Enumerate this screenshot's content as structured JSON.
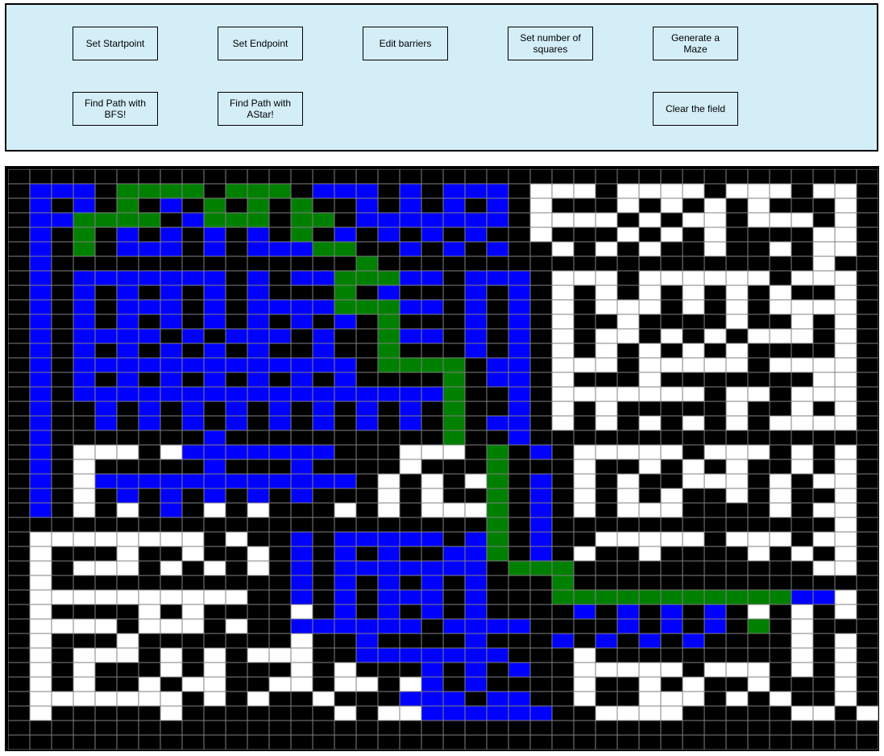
{
  "toolbar": {
    "set_startpoint": "Set Startpoint",
    "set_endpoint": "Set Endpoint",
    "edit_barriers": "Edit barriers",
    "set_number_of_squares": "Set number of squares",
    "generate_maze": "Generate a Maze",
    "find_path_bfs": "Find Path with BFS!",
    "find_path_astar": "Find Path with AStar!",
    "clear_field": "Clear the field"
  },
  "colors": {
    "panel": "#d4eef8",
    "wall": "#000000",
    "open": "#ffffff",
    "visited": "#0000ff",
    "path": "#008000",
    "gridline": "#808080"
  },
  "maze": {
    "cols": 40,
    "rows": 40,
    "legend": "B = wall, . = open, b = visited (blue), g = path (green)",
    "cells": [
      "BBBBBBBBBBBBBBBBBBBBBBBBBBBBBBBBBBBBBBBB",
      "BbbbBggggBgggBbbbBbBbbbB...B....B...B..B",
      "BbBbBgBbBgBgBgBBbBbBbBbB.BBB.B.B.B.BBB.B",
      "BbbggggBbgggBggBbbbbbbbB....B.B..B...B.B",
      "BbBgBbBbBbBbBgBbBbBbBbBB.BBB.B.B.BBBB..B",
      "BbBgBbbbBbBbbbggBBbBbBbBB.B.B.BB.BB.B..B",
      "BbBBBBBBBBBBBBBBgBBBBBBBBBBBBBBBBBBBB.BB",
      "BbBbbbbbbbBbBbbgggbbBbbbB...B......B...B",
      "BbBbBbBbBbBbBBBgBbBBBbBbB.B.B.B.B.B.BB.B",
      "BbBbBbbbBbBbbbbgggbbBbBbB.B...B.B.B....B",
      "BbBbBbBbBbBbBbBbBgBBBbBbB.BB.BBBB.BB.B.B",
      "BbBbbbbBbBbbbBbBBgbbBbBbB.B..B.B.B...B.B",
      "BbBbBbBbBbBbBBbBBgBBBbBbB.B.B.B.B.BBBB.B",
      "BbBbbbbbbbbbbbbbBggggBbbB...B.....B....B",
      "BbBbBbBbBbBbBbBbBBBBgBbbB.BBB.BBBBBBB..B",
      "BbBbbbbbbbbbbbbbbbbbgBBbB.......B..B...B",
      "BbBBbBbBbBbBbBbBbBbBgBBbB.B.BBBBB.BB.B.B",
      "BbBBbBbBbBbBbBbBbBbBgBbbB.B.B.B.B.B....B",
      "BbBBBBBBBbBBBBBBBBBBgBBbBBBBBBBBBBBBBBBB",
      "BbB...B.bbbbbbbBBB...BgBbB.....B...B.B.B",
      "BbB.BBBBBbBBBbBBBB.BBBgBBB.BB.B.B.BB.B.B",
      "BbB.bbbbbbbbbbbbB.B.B.gBbB.B.BB...B.B..B",
      "BbB.BbBbBbBbBbBBB.B.BBgBbB.B.B.BB.B.BB.B",
      "BbB.B.BbB.B.BBB.B.B...gBbB.B...BBBB.B..B",
      "BBBBBBBBBBBBBBBBBBBBBBgBbBBBBBBBBBBBBB.B",
      "B........B.BBbBbbbbbBbgBbBB.....B...B..B",
      "B.BBB.BB.BB.BbBbBbBBbbgBbB.BB.BBBB.B.B.B",
      "B.B...B.B.B.BbBbbbbbbbBgggBBBBBBBBBBB..B",
      "B.BBBBBBBBBBBbBbBbBbBbBBBgBBBBBBBBBBBBBB",
      "B..........BBbBbBbbbBbBBBgggggggggggbb.B",
      "B.BBBB.B.BBBB.BbBbBbBbBBBBbBbBbBbB.B.B.B",
      "B....B...B.BBbbbbbbBbbbbBBBBbBbBbBgB.BBB",
      "B.BBB.BBBBBBB.BBbBBBBbBBBbBbBbBbBBBB.B.B",
      "B.B...B.B.B...BBbbbbbbbBBB.BBBBBBBBB.B.B",
      "B.B.BBB.B.BBB.B.BBBbBbBbBB.....B...B.B.B",
      "B.B.BB.B..BB..B..B.bBbBBBB.BB.B.BB.BBB.B",
      "B.......B.B.BB.BBBbbbBbbBB.BB...B.B.BB.B",
      "B.BBBBB.BBBBBBB.B..bbbbbbBB....BBBBB..B.B",
      "BBBBBBBBBBBBBBBBBBBBBBBBBBBBBBBBBBBBBBBB",
      "BBBBBBBBBBBBBBBBBBBBBBBBBBBBBBBBBBBBBBBB"
    ]
  }
}
